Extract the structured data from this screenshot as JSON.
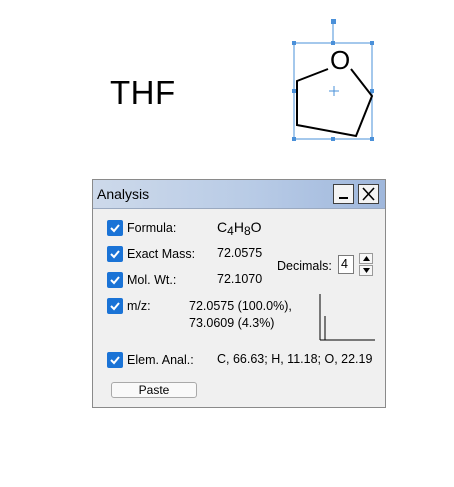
{
  "canvas": {
    "label": "THF",
    "molecule_atom": "O"
  },
  "panel": {
    "title": "Analysis",
    "formula": {
      "label": "Formula:",
      "value_parts": [
        "C",
        "4",
        "H",
        "8",
        "O"
      ],
      "checked": true
    },
    "exact_mass": {
      "label": "Exact Mass:",
      "value": "72.0575",
      "checked": true
    },
    "mol_wt": {
      "label": "Mol. Wt.:",
      "value": "72.1070",
      "checked": true
    },
    "mz": {
      "label": "m/z:",
      "line1": "72.0575 (100.0%),",
      "line2": "73.0609 (4.3%)",
      "checked": true
    },
    "elem_anal": {
      "label": "Elem. Anal.:",
      "value": "C, 66.63; H, 11.18; O, 22.19",
      "checked": true
    },
    "decimals": {
      "label": "Decimals:",
      "value": "4"
    },
    "paste_label": "Paste"
  },
  "colors": {
    "checkbox": "#1a73d6",
    "selection": "#4a90d9",
    "titlebar_start": "#cdd9ea",
    "titlebar_end": "#9fb7dc"
  }
}
